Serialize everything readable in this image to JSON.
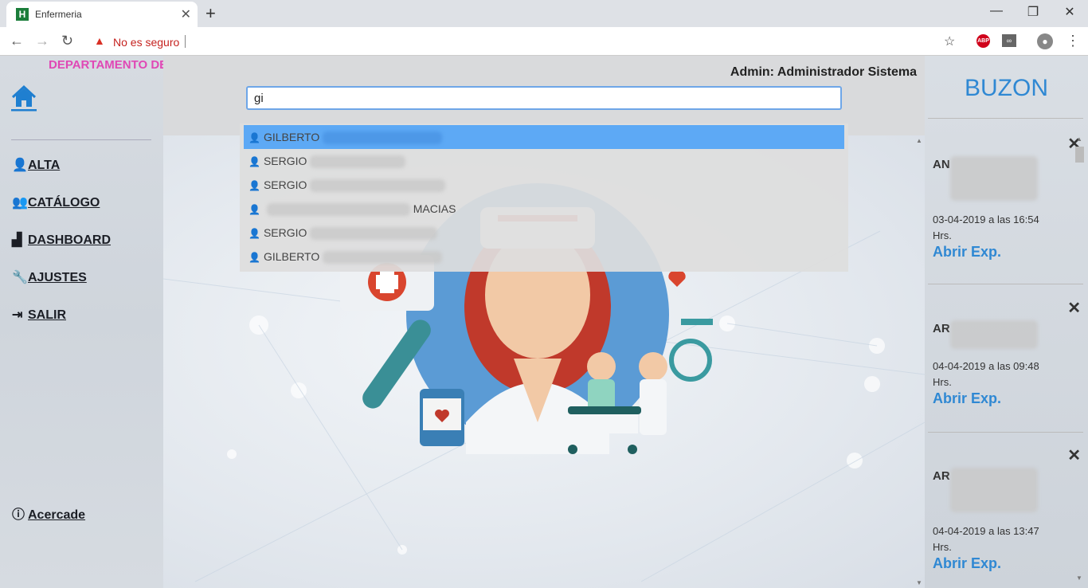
{
  "browser": {
    "tab_title": "Enfermeria",
    "tab_favicon": "H",
    "security_text": "No es seguro",
    "abp_label": "ABP"
  },
  "sidebar": {
    "dept_title": "DEPARTAMENTO DE ENFERMERIA",
    "items": [
      {
        "label": "ALTA",
        "icon": "user-icon"
      },
      {
        "label": "CATÁLOGO",
        "icon": "users-icon"
      },
      {
        "label": "DASHBOARD",
        "icon": "chart-icon"
      },
      {
        "label": "AJUSTES",
        "icon": "wrench-icon"
      },
      {
        "label": "SALIR",
        "icon": "exit-icon"
      }
    ],
    "about_label": "Acercade"
  },
  "header": {
    "admin_label": "Admin: Administrador Sistema"
  },
  "search": {
    "value": "gi"
  },
  "dropdown": {
    "items": [
      {
        "prefix": "GILBERTO",
        "suffix": "",
        "active": true
      },
      {
        "prefix": "SERGIO",
        "suffix": "",
        "active": false
      },
      {
        "prefix": "SERGIO",
        "suffix": "",
        "active": false
      },
      {
        "prefix": "",
        "suffix": "MACIAS",
        "active": false
      },
      {
        "prefix": "SERGIO",
        "suffix": "",
        "active": false
      },
      {
        "prefix": "GILBERTO",
        "suffix": "",
        "active": false
      }
    ]
  },
  "buzon": {
    "title": "BUZON",
    "messages": [
      {
        "name_start": "AN",
        "date": "03-04-2019 a las 16:54 Hrs.",
        "link": "Abrir Exp."
      },
      {
        "name_start": "AR",
        "date": "04-04-2019 a las 09:48 Hrs.",
        "link": "Abrir Exp."
      },
      {
        "name_start": "AR",
        "date": "04-04-2019 a las 13:47 Hrs.",
        "link": "Abrir Exp."
      }
    ]
  },
  "colors": {
    "dept_title": "#e048b5",
    "accent_blue": "#2f88d3",
    "dropdown_active": "#5da9f5"
  }
}
